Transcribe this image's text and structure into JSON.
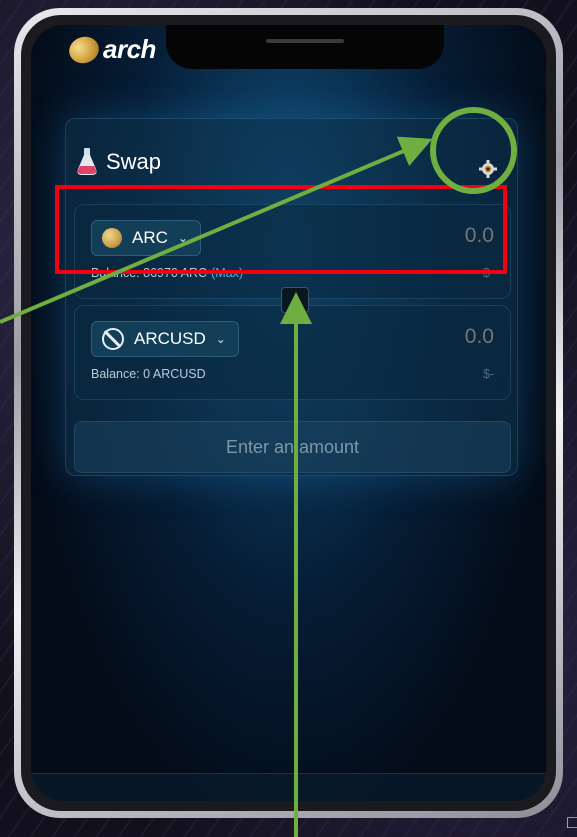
{
  "app": {
    "logo_text": "arch"
  },
  "swap": {
    "title": "Swap",
    "settings_icon": "gear-icon",
    "from": {
      "token": "ARC",
      "amount": "0.0",
      "balance_label": "Balance: 86970 ARC",
      "max_label": "(Max)",
      "usd": "$-"
    },
    "to": {
      "token": "ARCUSD",
      "amount": "0.0",
      "balance_label": "Balance: 0 ARCUSD",
      "usd": "$-"
    },
    "submit_label": "Enter an amount"
  },
  "annotations": {
    "highlight_color": "#f00010",
    "arrow_color": "#6fae40",
    "circle_color": "#6fae40"
  },
  "colors": {
    "accent": "#49b9e6",
    "card_bg": "#0e3450"
  }
}
